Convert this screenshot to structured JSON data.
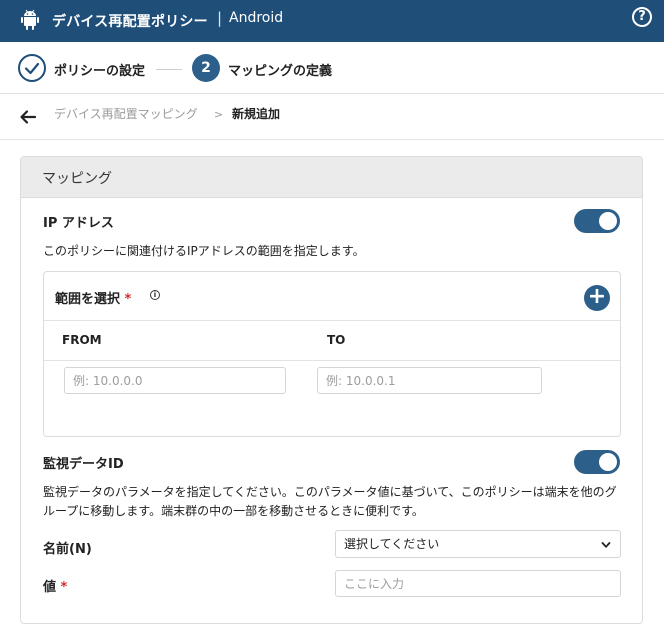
{
  "header": {
    "title": "デバイス再配置ポリシー",
    "separator": "|",
    "platform": "Android",
    "help_icon": "help-circle-icon",
    "logo_icon": "android-icon"
  },
  "stepper": {
    "step1_label": "ポリシーの設定",
    "step2_number": "2",
    "step2_label": "マッピングの定義"
  },
  "breadcrumb": {
    "parent": "デバイス再配置マッピング",
    "separator": ">",
    "current": "新規追加"
  },
  "card": {
    "title": "マッピング",
    "ip_section": {
      "label": "IP アドレス",
      "enabled": true,
      "description": "このポリシーに関連付けるIPアドレスの範囲を指定します。",
      "range_label": "範囲を選択",
      "required_mark": "*",
      "info_glyph": "i",
      "add_glyph": "+",
      "from_header": "FROM",
      "to_header": "TO",
      "from_placeholder": "例: 10.0.0.0",
      "to_placeholder": "例: 10.0.0.1"
    },
    "monitor_section": {
      "label": "監視データID",
      "enabled": true,
      "description": "監視データのパラメータを指定してください。このパラメータ値に基づいて、このポリシーは端末を他のグループに移動します。端末群の中の一部を移動させるときに便利です。",
      "name_label": "名前(N)",
      "select_value": "選択してください",
      "value_label": "値",
      "required_mark": "*",
      "value_placeholder": "ここに入力"
    }
  },
  "colors": {
    "header_bg": "#1f4e79",
    "accent": "#2d5f8b",
    "required": "#d0302f"
  }
}
